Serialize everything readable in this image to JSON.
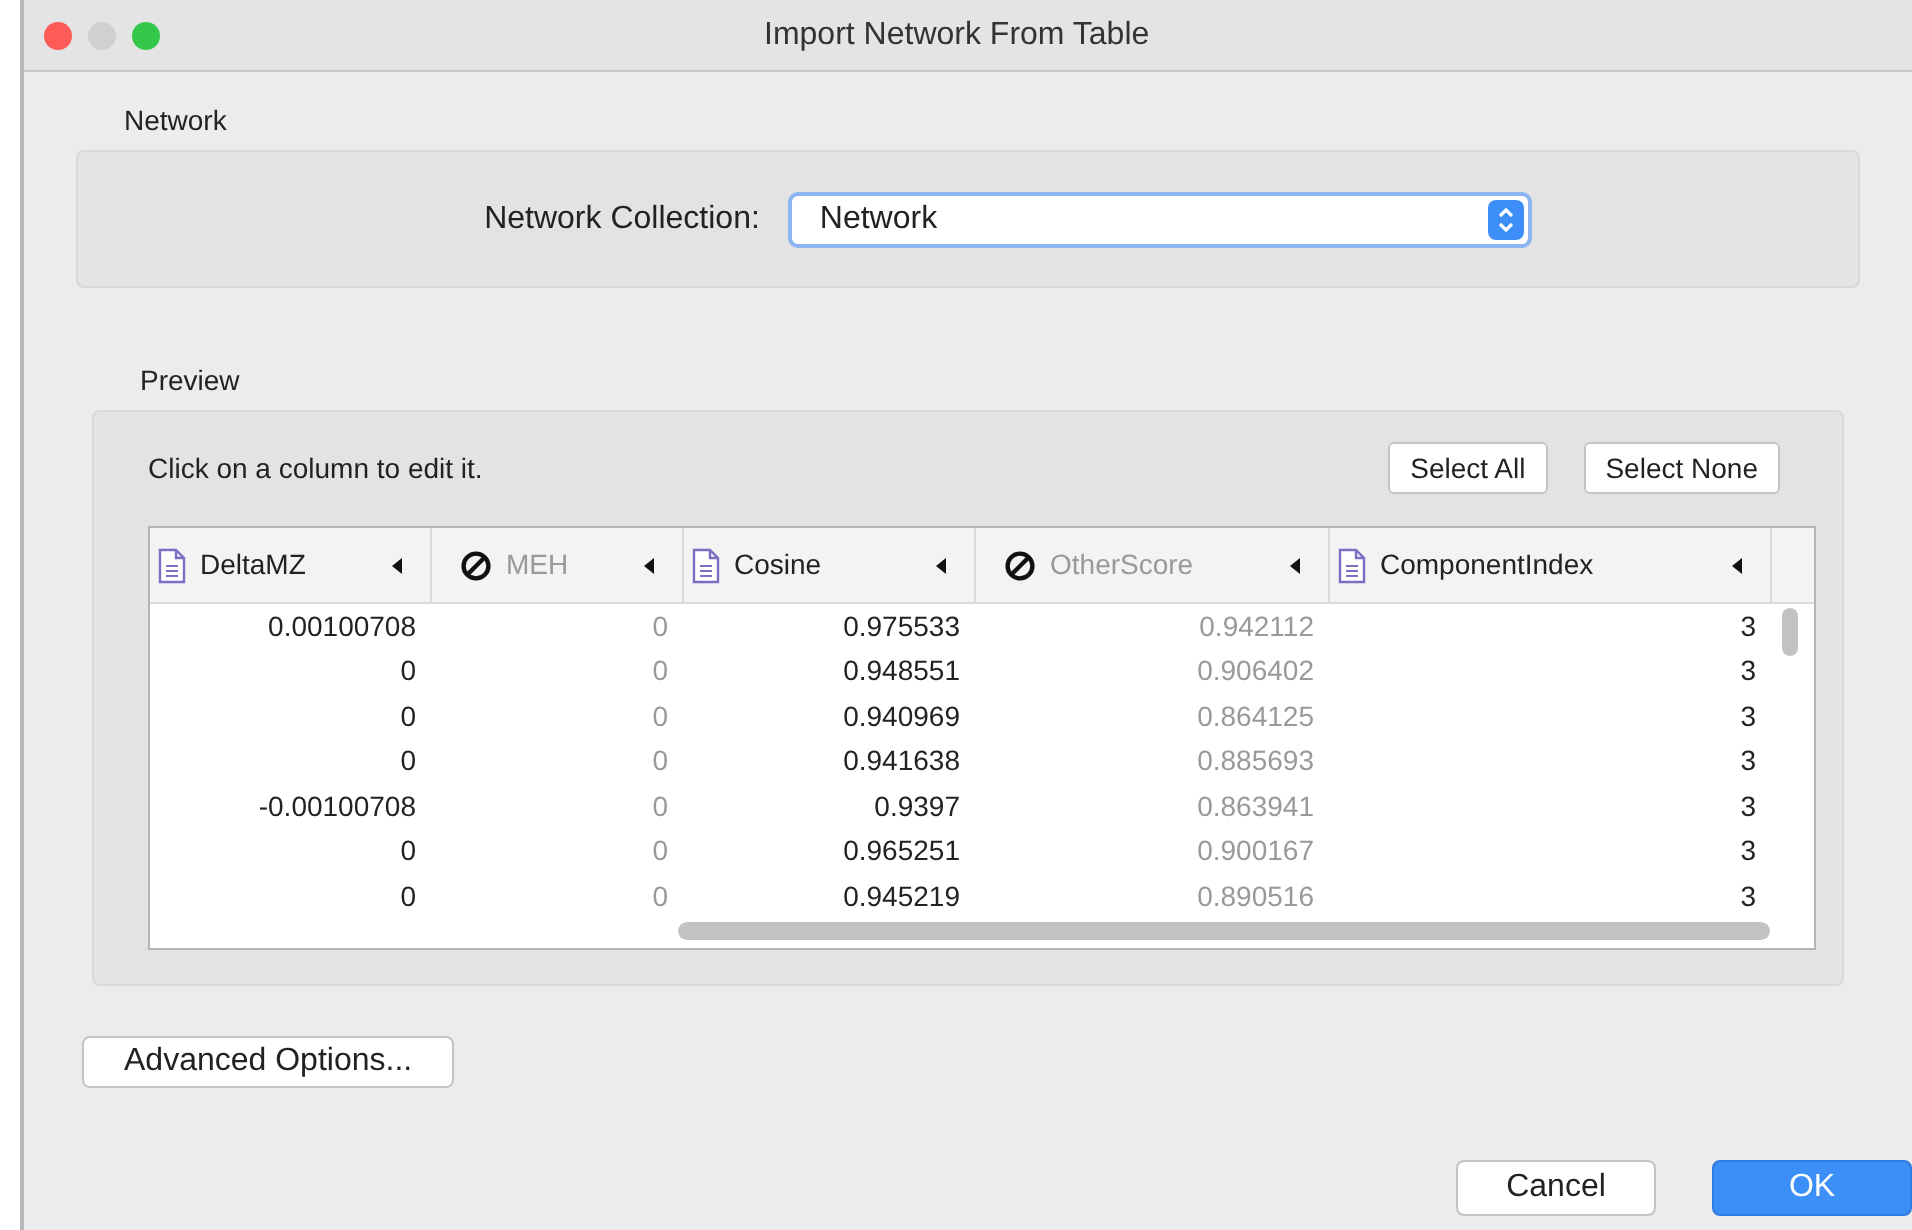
{
  "window": {
    "title": "Import Network From Table"
  },
  "network": {
    "label": "Network",
    "field_label": "Network Collection:",
    "value": "Network"
  },
  "preview": {
    "label": "Preview",
    "hint": "Click on a column to edit it.",
    "buttons": [
      "Select All",
      "Select None"
    ]
  },
  "table": {
    "columns": [
      {
        "name": "DeltaMZ",
        "skipped": false
      },
      {
        "name": "MEH",
        "skipped": true
      },
      {
        "name": "Cosine",
        "skipped": false
      },
      {
        "name": "OtherScore",
        "skipped": true
      },
      {
        "name": "ComponentIndex",
        "skipped": false
      }
    ],
    "rows": [
      [
        "0.00100708",
        "0",
        "0.975533",
        "0.942112",
        "3"
      ],
      [
        "0",
        "0",
        "0.948551",
        "0.906402",
        "3"
      ],
      [
        "0",
        "0",
        "0.940969",
        "0.864125",
        "3"
      ],
      [
        "0",
        "0",
        "0.941638",
        "0.885693",
        "3"
      ],
      [
        "-0.00100708",
        "0",
        "0.9397",
        "0.863941",
        "3"
      ],
      [
        "0",
        "0",
        "0.965251",
        "0.900167",
        "3"
      ],
      [
        "0",
        "0",
        "0.945219",
        "0.890516",
        "3"
      ]
    ]
  },
  "advanced_button": "Advanced Options...",
  "buttons": [
    {
      "label": "Cancel",
      "kind": "secondary"
    },
    {
      "label": "OK",
      "kind": "primary"
    }
  ]
}
